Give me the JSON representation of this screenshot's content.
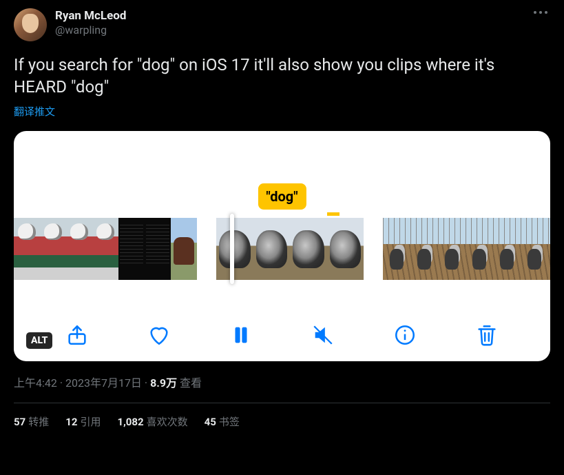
{
  "author": {
    "display_name": "Ryan McLeod",
    "handle": "@warpling"
  },
  "tweet_text": "If you search for \"dog\" on iOS 17 it'll also show you clips where it's HEARD \"dog\"",
  "translate_label": "翻译推文",
  "media": {
    "tooltip_text": "\"dog\"",
    "alt_badge": "ALT"
  },
  "meta": {
    "time": "上午4:42",
    "date": "2023年7月17日",
    "separator": " · ",
    "views_count": "8.9万",
    "views_label": " 查看"
  },
  "stats": {
    "retweets": {
      "count": "57",
      "label": "转推"
    },
    "quotes": {
      "count": "12",
      "label": "引用"
    },
    "likes": {
      "count": "1,082",
      "label": "喜欢次数"
    },
    "bookmarks": {
      "count": "45",
      "label": "书签"
    }
  }
}
